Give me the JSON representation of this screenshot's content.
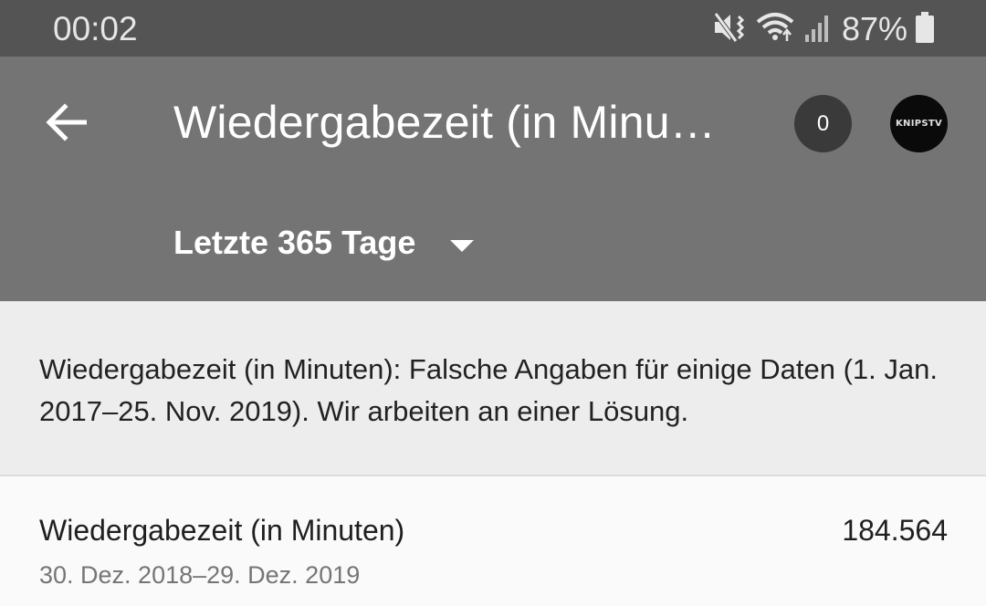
{
  "status_bar": {
    "time": "00:02",
    "battery": "87%",
    "icons": [
      "mute-vibrate-icon",
      "wifi-icon",
      "signal-icon",
      "battery-icon"
    ]
  },
  "app_bar": {
    "title": "Wiedergabezeit (in Minu…",
    "notification_count": "0",
    "date_range": "Letzte 365 Tage",
    "avatar_text": "KNIPSTV"
  },
  "notice": {
    "text": "Wiedergabezeit (in Minuten): Falsche Angaben für einige Daten (1. Jan. 2017–25. Nov. 2019). Wir arbeiten an einer Lösung."
  },
  "metric": {
    "label": "Wiedergabezeit (in Minuten)",
    "value": "184.564",
    "range": "30. Dez. 2018–29. Dez. 2019"
  },
  "colors": {
    "status_bar_bg": "#545454",
    "app_bar_bg": "#747474",
    "notice_bg": "#ededed",
    "content_bg": "#fafafa",
    "badge_bg": "#3a3a3a"
  }
}
